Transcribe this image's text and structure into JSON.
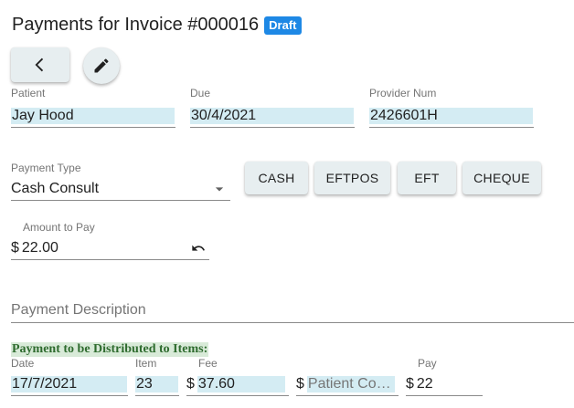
{
  "header": {
    "title": "Payments for Invoice #000016",
    "status_badge": "Draft"
  },
  "toolbar": {
    "back_icon": "chevron-left-icon",
    "edit_icon": "pencil-icon"
  },
  "patient": {
    "label": "Patient",
    "value": "Jay Hood"
  },
  "due": {
    "label": "Due",
    "value": "30/4/2021"
  },
  "provider": {
    "label": "Provider Num",
    "value": "2426601H"
  },
  "payment_type": {
    "label": "Payment Type",
    "selected": "Cash Consult",
    "buttons": [
      "CASH",
      "EFTPOS",
      "EFT",
      "CHEQUE"
    ]
  },
  "amount": {
    "label": "Amount to Pay",
    "prefix": "$",
    "value": "22.00",
    "reset_icon": "undo-icon"
  },
  "description": {
    "placeholder": "Payment Description"
  },
  "distribution": {
    "title": "Payment to be Distributed to Items:",
    "labels": {
      "date": "Date",
      "item": "Item",
      "fee": "Fee",
      "pay": "Pay"
    },
    "rows": [
      {
        "date": "17/7/2021",
        "item": "23",
        "fee_prefix": "$",
        "fee": "37.60",
        "contrib_prefix": "$",
        "contrib_placeholder": "Patient Cont…",
        "pay_prefix": "$",
        "pay": "22"
      }
    ]
  }
}
